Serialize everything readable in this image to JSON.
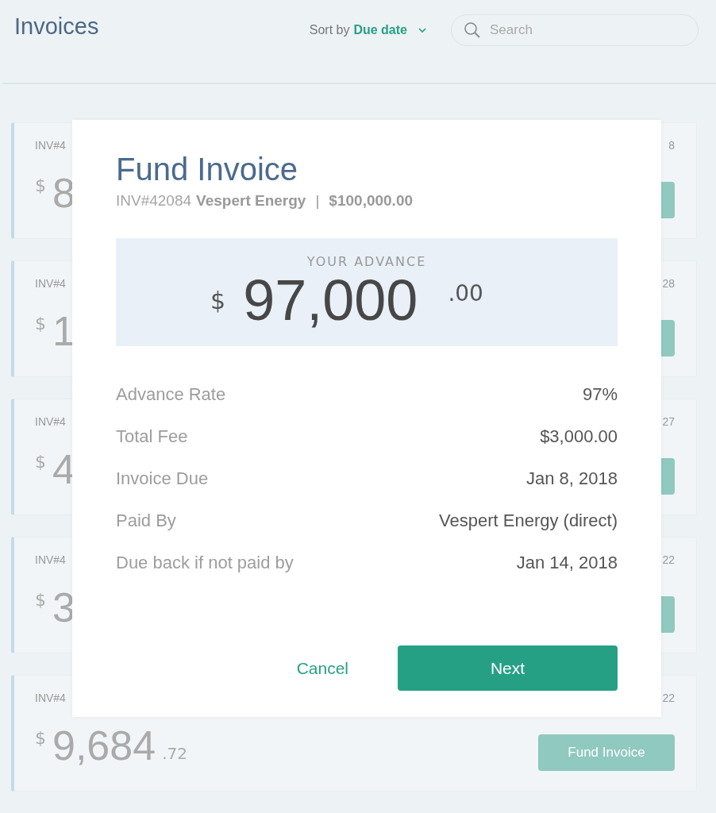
{
  "header": {
    "title": "Invoices",
    "sort_label": "Sort by",
    "sort_value": "Due date",
    "search": {
      "placeholder": "Search"
    }
  },
  "cards": [
    {
      "id": "INV#4",
      "currency": "$",
      "amount": "8",
      "date": "8"
    },
    {
      "id": "INV#4",
      "currency": "$",
      "amount": "1",
      "date": "28"
    },
    {
      "id": "INV#4",
      "currency": "$",
      "amount": "4",
      "date": "27"
    },
    {
      "id": "INV#4",
      "currency": "$",
      "amount": "3",
      "date": "22"
    },
    {
      "id": "INV#4",
      "currency": "$",
      "amount": "9,684",
      "cents": ".72",
      "date": "22",
      "button": "Fund Invoice"
    }
  ],
  "modal": {
    "title": "Fund Invoice",
    "invoice_number": "INV#42084",
    "customer": "Vespert Energy",
    "separator": "|",
    "total": "$100,000.00",
    "advance": {
      "label": "YOUR ADVANCE",
      "currency": "$",
      "amount": "97,000",
      "cents": ".00"
    },
    "details": [
      {
        "label": "Advance Rate",
        "value": "97%"
      },
      {
        "label": "Total Fee",
        "value": "$3,000.00"
      },
      {
        "label": "Invoice Due",
        "value": "Jan 8, 2018"
      },
      {
        "label": "Paid By",
        "value": "Vespert Energy (direct)"
      },
      {
        "label": "Due back if not paid by",
        "value": "Jan 14, 2018"
      }
    ],
    "cancel": "Cancel",
    "next": "Next"
  }
}
